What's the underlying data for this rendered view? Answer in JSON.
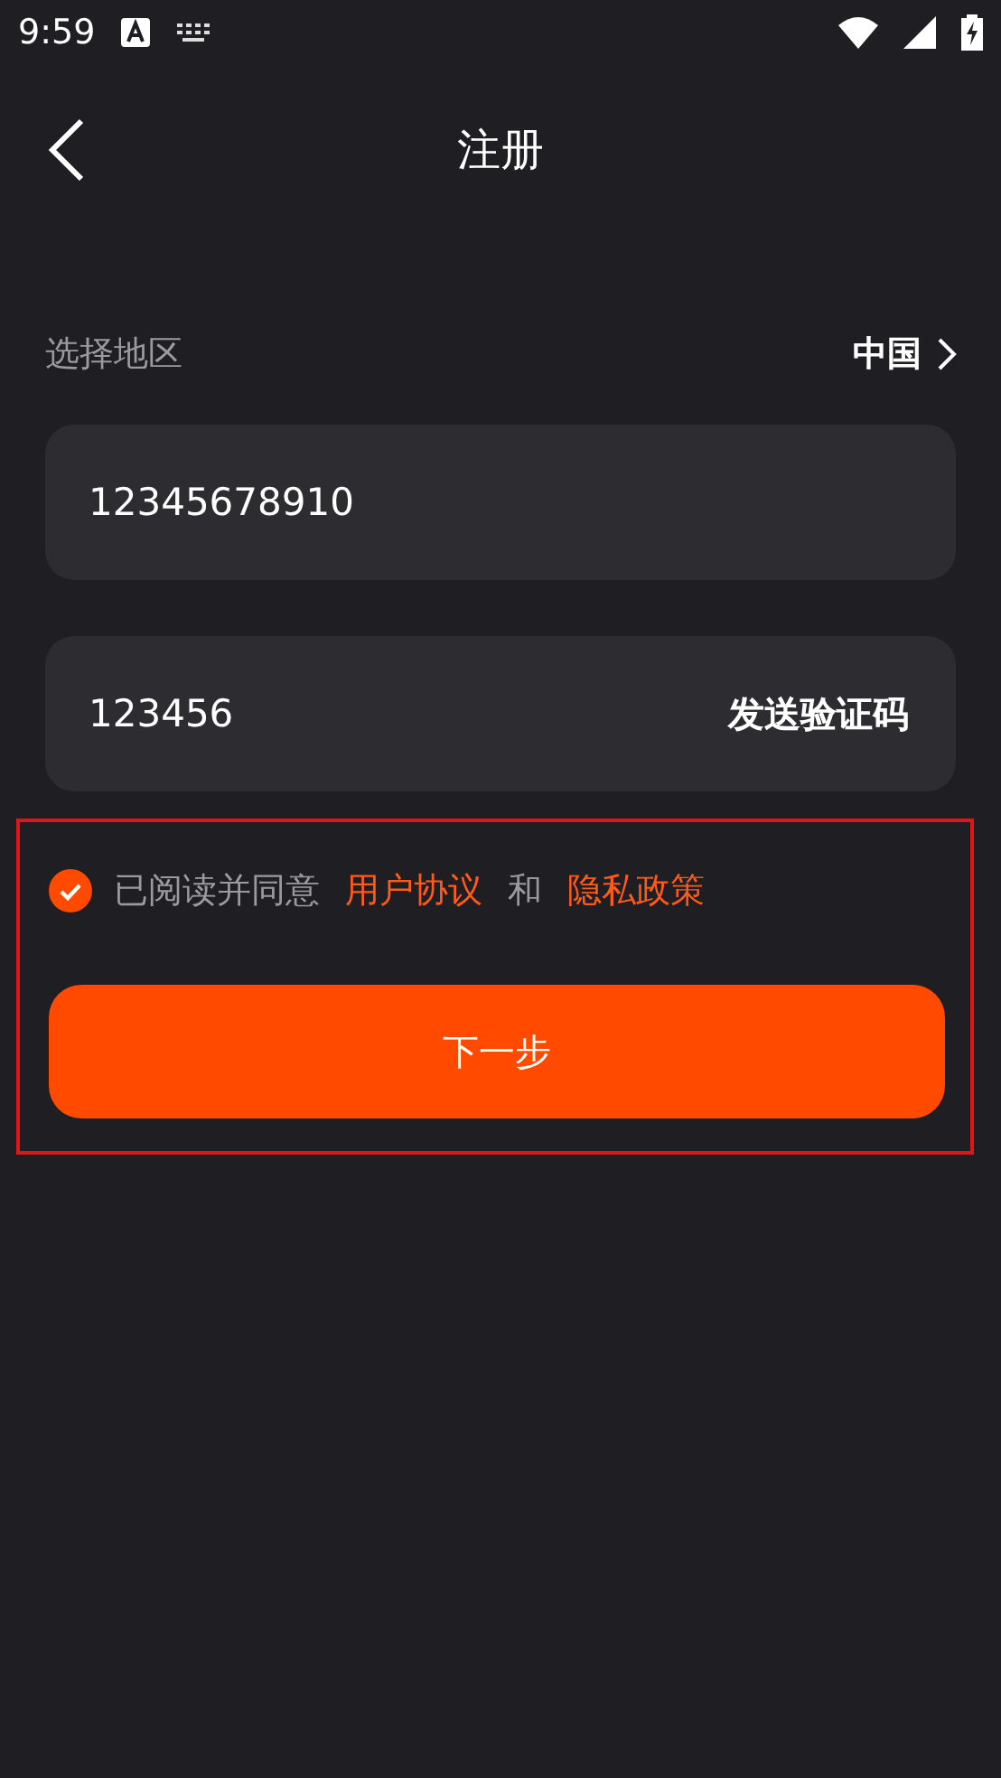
{
  "status_bar": {
    "time": "9:59"
  },
  "header": {
    "title": "注册"
  },
  "region": {
    "label": "选择地区",
    "value": "中国"
  },
  "phone_field": {
    "value": "12345678910"
  },
  "code_field": {
    "value": "123456",
    "action": "发送验证码"
  },
  "agreement": {
    "checked": true,
    "highlighted": true,
    "text": "已阅读并同意",
    "links": [
      "用户协议",
      "隐私政策"
    ],
    "joiner": "和"
  },
  "next_button": {
    "label": "下一步"
  }
}
